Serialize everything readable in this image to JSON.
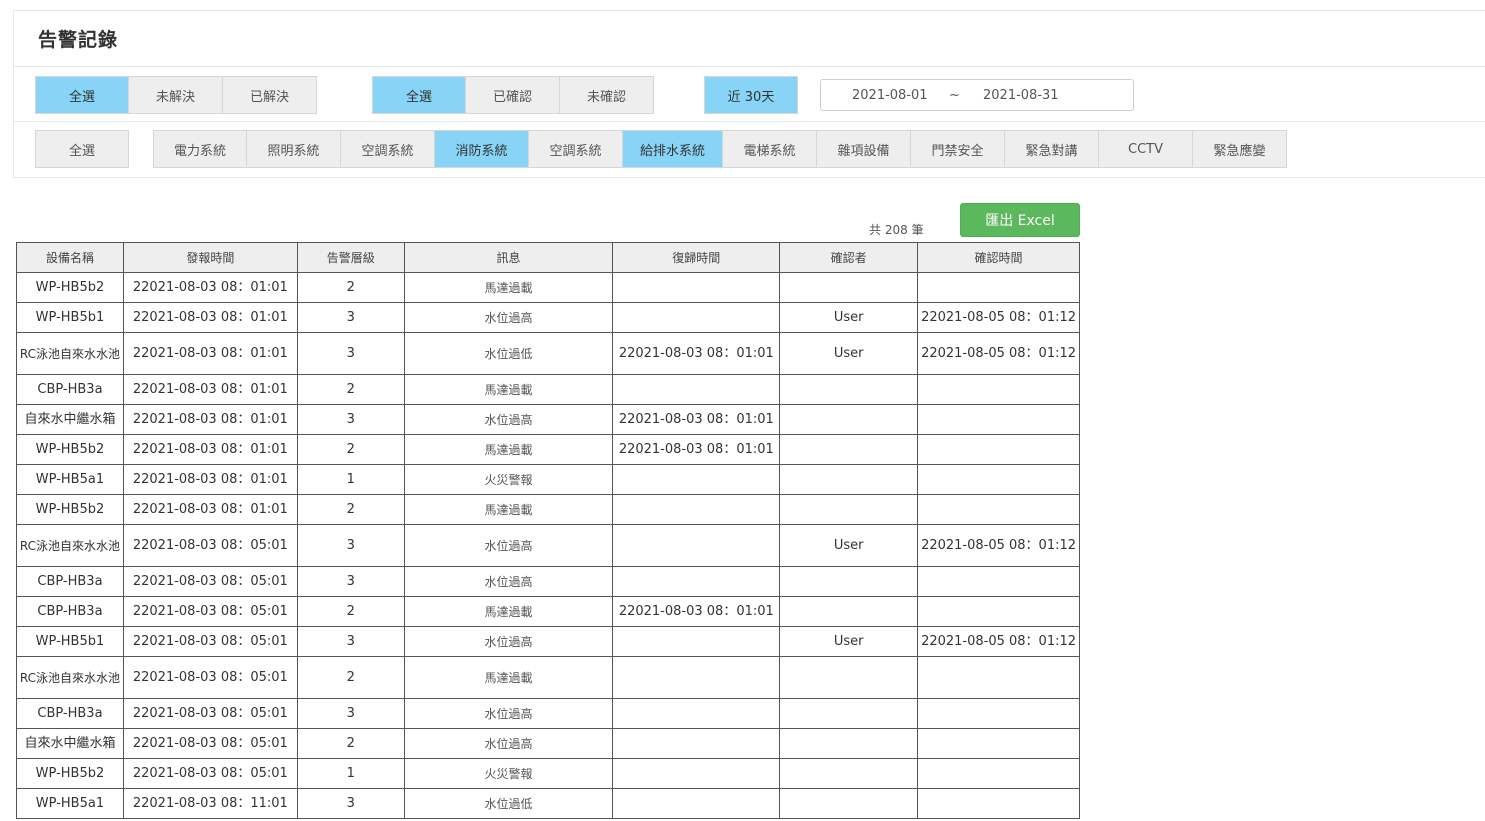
{
  "page": {
    "title": "告警記錄"
  },
  "status_filter": [
    "全選",
    "未解決",
    "已解決"
  ],
  "confirm_filter": [
    "全選",
    "已確認",
    "未確認"
  ],
  "range_button": "近 30天",
  "date_range": {
    "start": "2021-08-01",
    "separator": "~",
    "end": "2021-08-31"
  },
  "system_all": "全選",
  "systems": [
    "電力系統",
    "照明系統",
    "空調系統",
    "消防系統",
    "空調系統",
    "給排水系統",
    "電梯系統",
    "雜項設備",
    "門禁安全",
    "緊急對講",
    "CCTV",
    "緊急應變"
  ],
  "count_label": "共 208 筆",
  "export_label": "匯出 Excel",
  "colors": {
    "active": "#87d4f7",
    "export": "#5cb85c"
  },
  "table": {
    "headers": [
      "設備名稱",
      "發報時間",
      "告警層級",
      "訊息",
      "復歸時間",
      "確認者",
      "確認時間"
    ],
    "rows": [
      [
        "WP-HB5b2",
        "22021-08-03 08：01:01",
        "2",
        "馬達過載",
        "",
        "",
        ""
      ],
      [
        "WP-HB5b1",
        "22021-08-03 08：01:01",
        "3",
        "水位過高",
        "",
        "User",
        "22021-08-05 08：01:12"
      ],
      [
        "RC泳池自來水水池",
        "22021-08-03 08：01:01",
        "3",
        "水位過低",
        "22021-08-03 08：01:01",
        "User",
        "22021-08-05 08：01:12"
      ],
      [
        "CBP-HB3a",
        "22021-08-03 08：01:01",
        "2",
        "馬達過載",
        "",
        "",
        ""
      ],
      [
        "自來水中繼水箱",
        "22021-08-03 08：01:01",
        "3",
        "水位過高",
        "22021-08-03 08：01:01",
        "",
        ""
      ],
      [
        "WP-HB5b2",
        "22021-08-03 08：01:01",
        "2",
        "馬達過載",
        "22021-08-03 08：01:01",
        "",
        ""
      ],
      [
        "WP-HB5a1",
        "22021-08-03 08：01:01",
        "1",
        "火災警報",
        "",
        "",
        ""
      ],
      [
        "WP-HB5b2",
        "22021-08-03 08：01:01",
        "2",
        "馬達過載",
        "",
        "",
        ""
      ],
      [
        "RC泳池自來水水池",
        "22021-08-03 08：05:01",
        "3",
        "水位過高",
        "",
        "User",
        "22021-08-05 08：01:12"
      ],
      [
        "CBP-HB3a",
        "22021-08-03 08：05:01",
        "3",
        "水位過高",
        "",
        "",
        ""
      ],
      [
        "CBP-HB3a",
        "22021-08-03 08：05:01",
        "2",
        "馬達過載",
        "22021-08-03 08：01:01",
        "",
        ""
      ],
      [
        "WP-HB5b1",
        "22021-08-03 08：05:01",
        "3",
        "水位過高",
        "",
        "User",
        "22021-08-05 08：01:12"
      ],
      [
        "RC泳池自來水水池",
        "22021-08-03 08：05:01",
        "2",
        "馬達過載",
        "",
        "",
        ""
      ],
      [
        "CBP-HB3a",
        "22021-08-03 08：05:01",
        "3",
        "水位過高",
        "",
        "",
        ""
      ],
      [
        "自來水中繼水箱",
        "22021-08-03 08：05:01",
        "2",
        "水位過高",
        "",
        "",
        ""
      ],
      [
        "WP-HB5b2",
        "22021-08-03 08：05:01",
        "1",
        "火災警報",
        "",
        "",
        ""
      ],
      [
        "WP-HB5a1",
        "22021-08-03 08：11:01",
        "3",
        "水位過低",
        "",
        "",
        ""
      ]
    ]
  }
}
